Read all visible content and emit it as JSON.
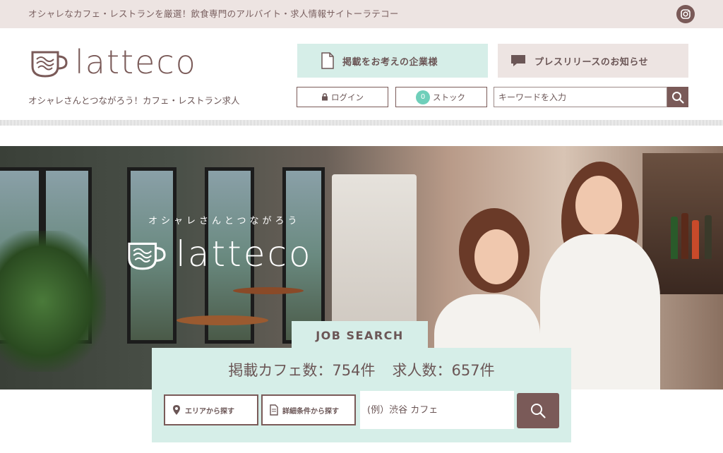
{
  "topbar": {
    "text": "オシャレなカフェ・レストランを厳選！飲食専門のアルバイト・求人情報サイトーラテコー",
    "instagram_icon": "instagram-icon"
  },
  "header": {
    "logo_text": "latteco",
    "tagline": "オシャレさんとつながろう！カフェ・レストラン求人",
    "corp_button": "掲載をお考えの企業様",
    "press_button": "プレスリリースのお知らせ",
    "login_button": "ログイン",
    "stock_count": "0",
    "stock_label": "ストック",
    "search_placeholder": "キーワードを入力"
  },
  "hero": {
    "catch": "オシャレさんとつながろう",
    "logo_text": "latteco"
  },
  "job_search": {
    "tab_label": "JOB SEARCH",
    "cafe_count_label": "掲載カフェ数：754件",
    "job_count_label": "求人数：657件",
    "area_button": "エリアから探す",
    "detail_button": "詳細条件から探す",
    "input_placeholder": "(例）渋谷 カフェ"
  },
  "colors": {
    "brand_brown": "#7a5a58",
    "mint": "#d6eee8",
    "beige": "#ede4e2",
    "stock_badge": "#6fcfba"
  }
}
